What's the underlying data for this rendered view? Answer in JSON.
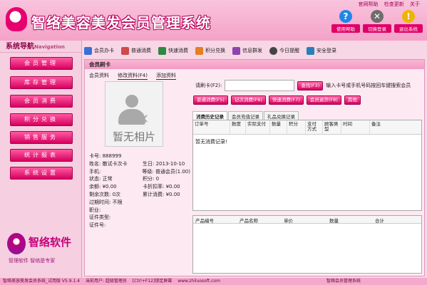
{
  "app": {
    "title": "智络美容美发会员管理系统",
    "top_links": [
      "官网帮助",
      "检查更新",
      "关于"
    ],
    "top_buttons": [
      {
        "label": "使用帮助",
        "icon": "help-icon",
        "color": "#1e88e5",
        "glyph": "?"
      },
      {
        "label": "切换登录",
        "icon": "tools-icon",
        "color": "#6d6d6d",
        "glyph": "✕"
      },
      {
        "label": "退出系统",
        "icon": "warning-icon",
        "color": "#f0b400",
        "glyph": "!"
      }
    ]
  },
  "sidebar": {
    "title": "系统导航",
    "title_en": "Navigation",
    "items": [
      "会员管理",
      "库存管理",
      "会员消费",
      "积分兑换",
      "销售服务",
      "统计报表",
      "系统设置"
    ],
    "brand_name": "智络软件",
    "brand_slogan": "管理软件 智络是专家"
  },
  "toolbar": [
    {
      "label": "会员办卡",
      "icon": "card-icon",
      "color": "#3b6fd6"
    },
    {
      "label": "普通消费",
      "icon": "cash-icon",
      "color": "#d04a4a"
    },
    {
      "label": "快速消费",
      "icon": "fast-icon",
      "color": "#2b8a3e"
    },
    {
      "label": "积分兑换",
      "icon": "gift-icon",
      "color": "#e67e22"
    },
    {
      "label": "信息群发",
      "icon": "message-icon",
      "color": "#8e44ad"
    },
    {
      "label": "今日提醒",
      "icon": "clock-icon",
      "color": "#444444"
    },
    {
      "label": "安全登录",
      "icon": "lock-icon",
      "color": "#2980b9"
    }
  ],
  "panel": {
    "title": "会员刷卡",
    "left_tabs": [
      "会员资料",
      "修改资料(F4)",
      "添加资料"
    ],
    "photo_text": "暂无相片",
    "card_label": "请刷卡(F2):",
    "card_value": "",
    "search_button": "查找(F3)",
    "hint": "输入卡号或手机号码按回车键搜索会员",
    "action_buttons": [
      "普通消费(F5)",
      "记次消费(F6)",
      "快速消费(F7)",
      "会员退货(F8)",
      "其他"
    ],
    "tabs": [
      "消费历史记录",
      "会员充值记录",
      "礼品兑换记录"
    ],
    "grid_columns": [
      "订单号",
      "数度",
      "实际支付",
      "数量",
      "积分",
      "支付方式",
      "顾客类型",
      "时间",
      "备注"
    ],
    "grid_empty": "暂无消费记录!",
    "detail_columns": [
      "产品编号",
      "产品名称",
      "单价",
      "数量",
      "合计"
    ]
  },
  "member": {
    "rows": [
      [
        "卡号: 888999",
        ""
      ],
      [
        "姓名: 散试卡次卡",
        "生日: 2013-10-10"
      ],
      [
        "手机:",
        "等级: 普通会员(1.00)"
      ],
      [
        "状态: 正常",
        "积分: 0"
      ],
      [
        "余额: ¥0.00",
        "卡折扣率: ¥0.00"
      ],
      [
        "剩余次数: 0次",
        "累计消费: ¥0.00"
      ],
      [
        "过期时间: 不限",
        ""
      ],
      [
        "职业:",
        ""
      ],
      [
        "证件类型:",
        ""
      ],
      [
        "证件号:",
        ""
      ]
    ]
  },
  "status": {
    "items": [
      "智络美容美发会员系统_试用版 V5.9.1.4",
      "当前用户: 超级管理员",
      "[Ctrl+F12]锁定屏幕",
      "www.zhiluosoft.com"
    ],
    "brand": "智络会员管理系统"
  }
}
